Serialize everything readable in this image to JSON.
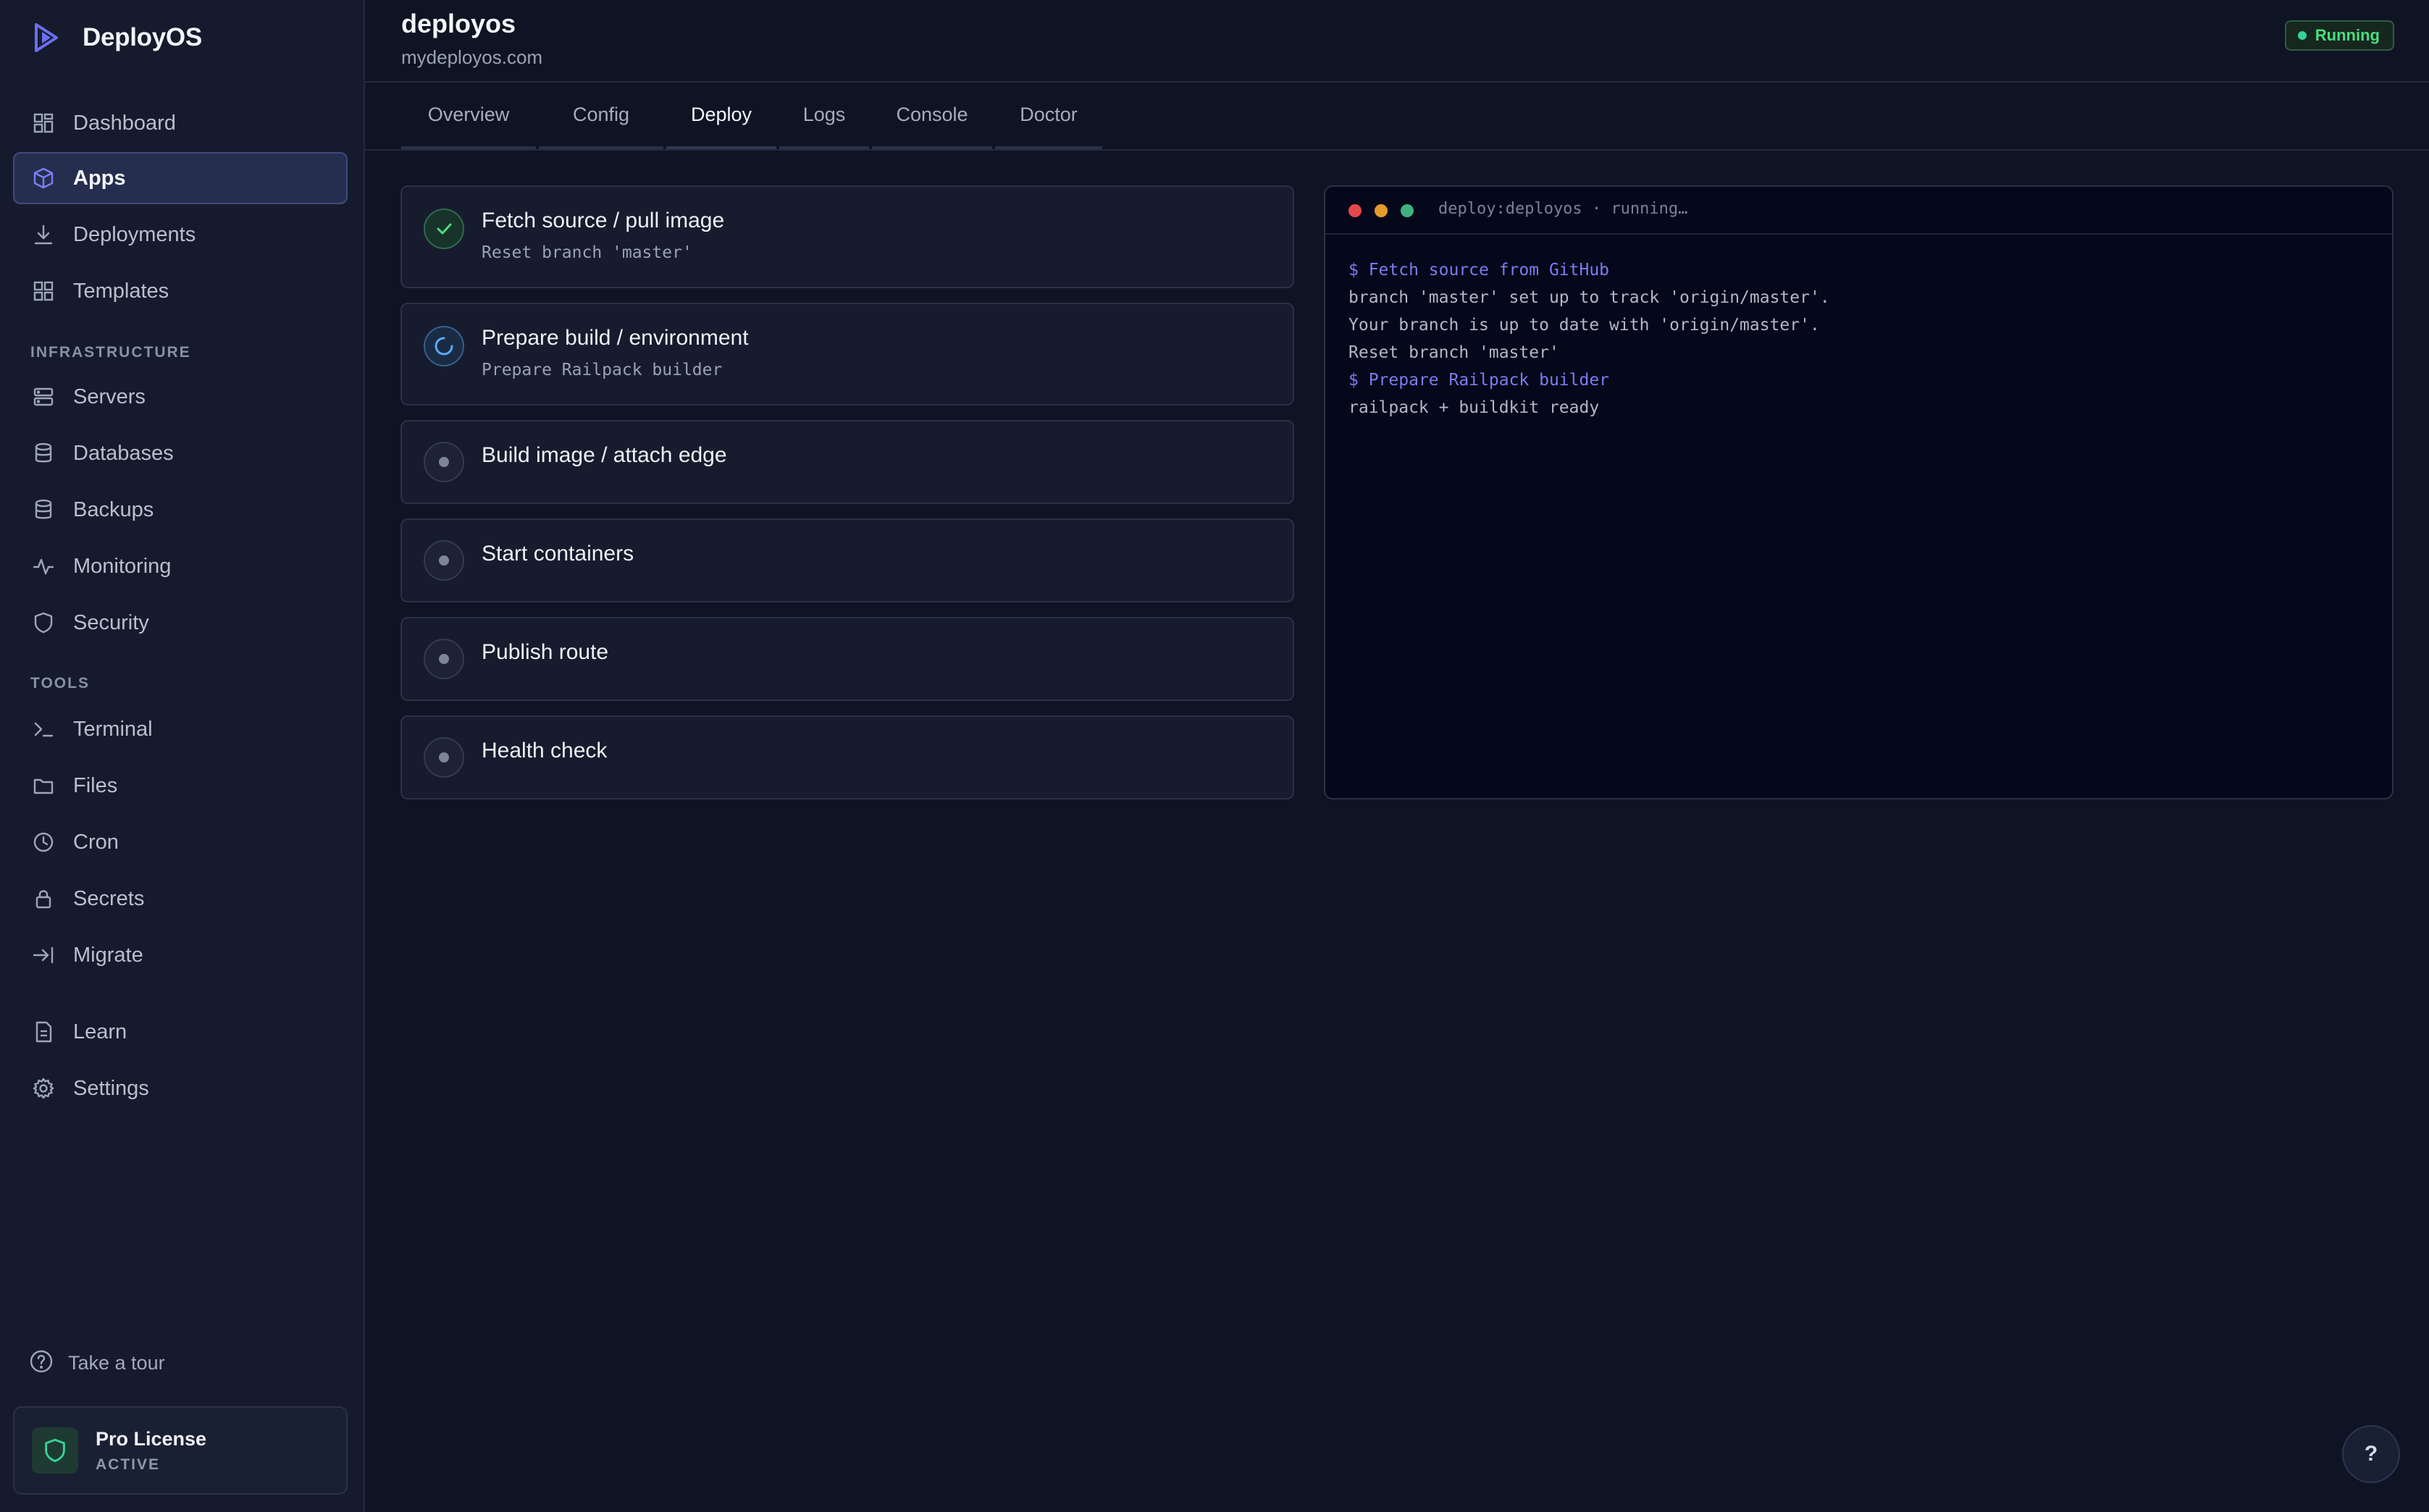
{
  "brand": {
    "name": "DeployOS",
    "accent": "#6c6ff0"
  },
  "sidebar": {
    "main_items": [
      {
        "label": "Dashboard",
        "icon": "dashboard-icon"
      },
      {
        "label": "Apps",
        "icon": "cube-icon",
        "active": true
      },
      {
        "label": "Deployments",
        "icon": "download-icon"
      },
      {
        "label": "Templates",
        "icon": "grid-icon"
      }
    ],
    "infrastructure_label": "INFRASTRUCTURE",
    "infrastructure_items": [
      {
        "label": "Servers",
        "icon": "server-icon"
      },
      {
        "label": "Databases",
        "icon": "database-icon"
      },
      {
        "label": "Backups",
        "icon": "database-icon"
      },
      {
        "label": "Monitoring",
        "icon": "activity-icon"
      },
      {
        "label": "Security",
        "icon": "shield-icon"
      }
    ],
    "tools_label": "TOOLS",
    "tools_items": [
      {
        "label": "Terminal",
        "icon": "terminal-icon"
      },
      {
        "label": "Files",
        "icon": "folder-icon"
      },
      {
        "label": "Cron",
        "icon": "clock-icon"
      },
      {
        "label": "Secrets",
        "icon": "lock-icon"
      },
      {
        "label": "Migrate",
        "icon": "arrow-right-to-line-icon"
      }
    ],
    "bottom_items": [
      {
        "label": "Learn",
        "icon": "document-icon"
      },
      {
        "label": "Settings",
        "icon": "gear-icon"
      }
    ],
    "tour_label": "Take a tour",
    "license": {
      "title": "Pro License",
      "status": "ACTIVE"
    }
  },
  "header": {
    "app_name": "deployos",
    "domain": "mydeployos.com",
    "status": "Running",
    "status_color": "#34d399"
  },
  "tabs": [
    {
      "label": "Overview"
    },
    {
      "label": "Config"
    },
    {
      "label": "Deploy",
      "active": true
    },
    {
      "label": "Logs"
    },
    {
      "label": "Console"
    },
    {
      "label": "Doctor"
    }
  ],
  "steps": [
    {
      "title": "Fetch source / pull image",
      "subtitle": "Reset branch 'master'",
      "state": "done"
    },
    {
      "title": "Prepare build / environment",
      "subtitle": "Prepare Railpack builder",
      "state": "running"
    },
    {
      "title": "Build image / attach edge",
      "state": "pending"
    },
    {
      "title": "Start containers",
      "state": "pending"
    },
    {
      "title": "Publish route",
      "state": "pending"
    },
    {
      "title": "Health check",
      "state": "pending"
    }
  ],
  "terminal": {
    "title": "deploy:deployos · running…",
    "lines": [
      {
        "text": "$ Fetch source from GitHub",
        "cmd": true
      },
      {
        "text": "branch 'master' set up to track 'origin/master'."
      },
      {
        "text": "Your branch is up to date with 'origin/master'."
      },
      {
        "text": "Reset branch 'master'"
      },
      {
        "text": "$ Prepare Railpack builder",
        "cmd": true
      },
      {
        "text": "railpack + buildkit ready"
      }
    ]
  },
  "help": {
    "label": "?"
  }
}
